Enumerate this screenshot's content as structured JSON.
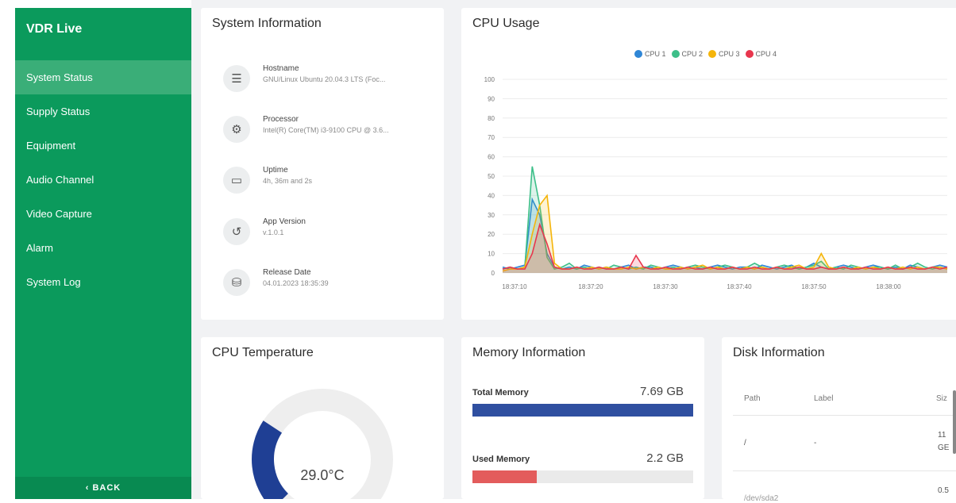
{
  "sidebar": {
    "app_title": "VDR Live",
    "items": [
      {
        "label": "System Status"
      },
      {
        "label": "Supply Status"
      },
      {
        "label": "Equipment"
      },
      {
        "label": "Audio Channel"
      },
      {
        "label": "Video Capture"
      },
      {
        "label": "Alarm"
      },
      {
        "label": "System Log"
      }
    ],
    "back_label": "‹ BACK"
  },
  "system_info": {
    "title": "System Information",
    "rows": [
      {
        "icon": "server-icon",
        "glyph": "☰",
        "label": "Hostname",
        "value": "GNU/Linux Ubuntu 20.04.3 LTS (Foc..."
      },
      {
        "icon": "processor-icon",
        "glyph": "⚙",
        "label": "Processor",
        "value": "Intel(R) Core(TM) i3-9100 CPU @ 3.6..."
      },
      {
        "icon": "calendar-icon",
        "glyph": "▭",
        "label": "Uptime",
        "value": "4h, 36m and 2s"
      },
      {
        "icon": "history-icon",
        "glyph": "↺",
        "label": "App Version",
        "value": "v.1.0.1"
      },
      {
        "icon": "database-clock-icon",
        "glyph": "⛁",
        "label": "Release Date",
        "value": "04.01.2023 18:35:39"
      }
    ]
  },
  "cpu_usage": {
    "title": "CPU Usage",
    "chart_data": {
      "type": "line",
      "ylim": [
        0,
        100
      ],
      "yticks": [
        0,
        10,
        20,
        30,
        40,
        50,
        60,
        70,
        80,
        90,
        100
      ],
      "x_ticks": [
        "18:37:10",
        "18:37:20",
        "18:37:30",
        "18:37:40",
        "18:37:50",
        "18:38:00"
      ],
      "x": [
        0,
        1,
        2,
        3,
        4,
        5,
        6,
        7,
        8,
        9,
        10,
        11,
        12,
        13,
        14,
        15,
        16,
        17,
        18,
        19,
        20,
        21,
        22,
        23,
        24,
        25,
        26,
        27,
        28,
        29,
        30,
        31,
        32,
        33,
        34,
        35,
        36,
        37,
        38,
        39,
        40,
        41,
        42,
        43,
        44,
        45,
        46,
        47,
        48,
        49,
        50,
        51,
        52,
        53,
        54,
        55,
        56,
        57,
        58,
        59,
        60
      ],
      "x_origin_label": "18:37:10",
      "x_units": "seconds",
      "x_start": -3,
      "series": [
        {
          "name": "CPU 1",
          "color": "#2f86d6",
          "values": [
            3,
            2,
            3,
            4,
            38,
            30,
            10,
            3,
            2,
            3,
            2,
            4,
            3,
            2,
            3,
            2,
            3,
            4,
            2,
            3,
            3,
            2,
            3,
            4,
            3,
            2,
            3,
            2,
            3,
            4,
            3,
            2,
            3,
            3,
            2,
            4,
            3,
            2,
            3,
            4,
            2,
            3,
            5,
            3,
            2,
            3,
            4,
            3,
            2,
            3,
            4,
            3,
            2,
            3,
            2,
            4,
            3,
            2,
            3,
            4,
            3
          ]
        },
        {
          "name": "CPU 2",
          "color": "#3dbf89",
          "values": [
            2,
            3,
            2,
            3,
            55,
            35,
            8,
            2,
            3,
            5,
            2,
            3,
            2,
            3,
            2,
            4,
            3,
            2,
            3,
            2,
            4,
            3,
            2,
            3,
            2,
            3,
            4,
            3,
            2,
            3,
            4,
            3,
            2,
            3,
            5,
            3,
            2,
            3,
            4,
            3,
            2,
            3,
            4,
            6,
            2,
            3,
            2,
            4,
            3,
            2,
            3,
            3,
            2,
            4,
            2,
            3,
            5,
            3,
            2,
            3,
            2
          ]
        },
        {
          "name": "CPU 3",
          "color": "#f5b50a",
          "values": [
            1,
            2,
            2,
            3,
            20,
            35,
            40,
            5,
            2,
            2,
            3,
            2,
            3,
            2,
            3,
            2,
            2,
            3,
            2,
            3,
            2,
            3,
            2,
            2,
            3,
            2,
            3,
            4,
            2,
            3,
            2,
            3,
            2,
            3,
            2,
            3,
            2,
            3,
            2,
            3,
            4,
            2,
            3,
            10,
            3,
            2,
            3,
            2,
            3,
            2,
            3,
            2,
            3,
            2,
            3,
            2,
            3,
            2,
            3,
            3,
            2
          ]
        },
        {
          "name": "CPU 4",
          "color": "#e8364d",
          "values": [
            2,
            3,
            2,
            2,
            10,
            25,
            15,
            3,
            2,
            2,
            3,
            2,
            2,
            3,
            2,
            2,
            3,
            2,
            9,
            3,
            2,
            2,
            3,
            2,
            2,
            3,
            2,
            2,
            3,
            2,
            2,
            3,
            2,
            2,
            3,
            2,
            2,
            3,
            2,
            2,
            3,
            2,
            2,
            3,
            2,
            2,
            3,
            2,
            2,
            3,
            2,
            2,
            3,
            2,
            2,
            3,
            2,
            2,
            3,
            2,
            3
          ]
        }
      ]
    }
  },
  "cpu_temp": {
    "title": "CPU Temperature",
    "value_text": "29.0°C",
    "gauge_fraction": 0.29,
    "gauge_color": "#1f3f94",
    "track_color": "#eeeeee"
  },
  "memory": {
    "title": "Memory Information",
    "total_label": "Total Memory",
    "total_value": "7.69 GB",
    "total_fraction": 1.0,
    "total_color": "#2f4fa0",
    "used_label": "Used Memory",
    "used_value": "2.2 GB",
    "used_fraction": 0.29,
    "used_color": "#e35c5c"
  },
  "disk": {
    "title": "Disk Information",
    "columns": [
      "Path",
      "Label",
      "Siz"
    ],
    "rows": [
      {
        "path": "/",
        "label": "-",
        "size_line1": "11",
        "size_line2": "GE"
      },
      {
        "path": "/dev/sda2",
        "label": "",
        "size_line1": "0.5",
        "size_line2": ""
      }
    ]
  }
}
